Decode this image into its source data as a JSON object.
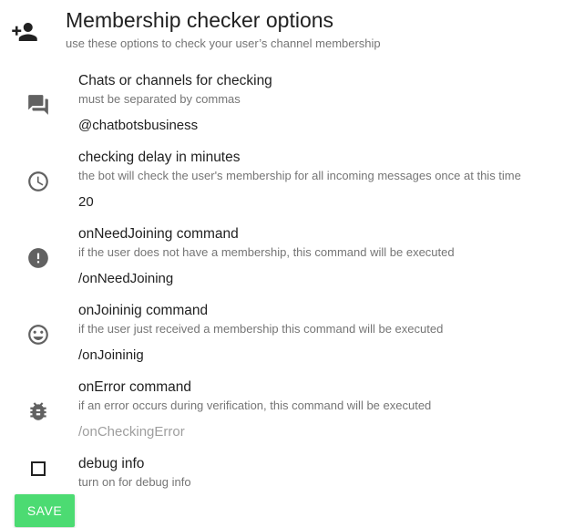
{
  "header": {
    "title": "Membership checker options",
    "subtitle": "use these options to check your user’s channel membership",
    "icon": "person-add-icon"
  },
  "fields": [
    {
      "icon": "forum-icon",
      "label": "Chats or channels for checking",
      "hint": "must be separated by commas",
      "value": "@chatbotsbusiness",
      "placeholder": ""
    },
    {
      "icon": "clock-icon",
      "label": "checking delay in minutes",
      "hint": "the bot will check the user's membership for all incoming messages once at this time",
      "value": "20",
      "placeholder": ""
    },
    {
      "icon": "alert-circle-icon",
      "label": "onNeedJoining command",
      "hint": "if the user does not have a membership, this command will be executed",
      "value": "/onNeedJoining",
      "placeholder": ""
    },
    {
      "icon": "smiley-icon",
      "label": "onJoininig command",
      "hint": "if the user just received a membership this command will be executed",
      "value": "/onJoininig",
      "placeholder": ""
    },
    {
      "icon": "bug-icon",
      "label": "onError command",
      "hint": "if an error occurs during verification, this command will be executed",
      "value": "",
      "placeholder": "/onCheckingError"
    }
  ],
  "debug": {
    "label": "debug info",
    "hint": "turn on for debug info",
    "checked": false
  },
  "save_label": "SAVE",
  "colors": {
    "accent": "#4cdb72",
    "icon": "#616161",
    "hint": "#757575"
  }
}
